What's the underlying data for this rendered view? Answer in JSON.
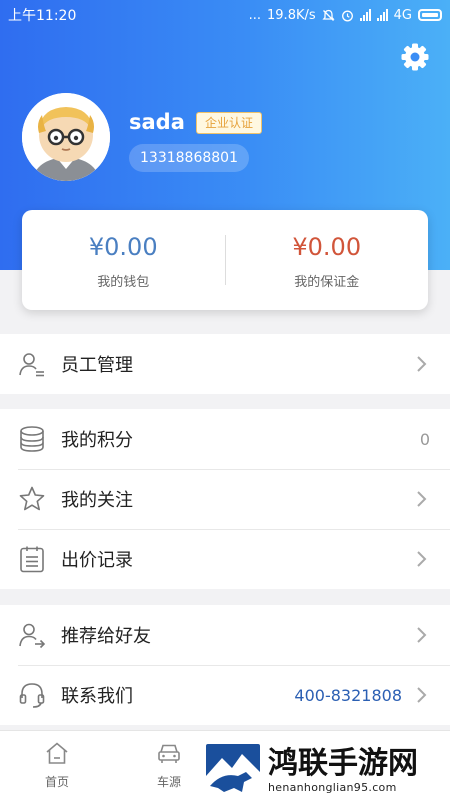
{
  "status_bar": {
    "time": "上午11:20",
    "dots": "...",
    "net_speed": "19.8K/s",
    "network": "4G"
  },
  "profile": {
    "username": "sada",
    "badge": "企业认证",
    "phone": "13318868801"
  },
  "wallet": {
    "balance": "¥0.00",
    "balance_label": "我的钱包",
    "deposit": "¥0.00",
    "deposit_label": "我的保证金"
  },
  "menu": {
    "staff": "员工管理",
    "points": "我的积分",
    "points_value": "0",
    "follow": "我的关注",
    "bids": "出价记录",
    "recommend": "推荐给好友",
    "contact": "联系我们",
    "contact_phone": "400-8321808"
  },
  "tabbar": {
    "home": "首页",
    "cars": "车源"
  },
  "watermark": {
    "title": "鸿联手游网",
    "url": "henanhonglian95.com"
  },
  "colors": {
    "header_gradient_start": "#2f6df0",
    "header_gradient_end": "#4bb0f7",
    "balance_blue": "#4a7fc1",
    "deposit_red": "#d1553a",
    "contact_blue": "#2b5fb3"
  }
}
